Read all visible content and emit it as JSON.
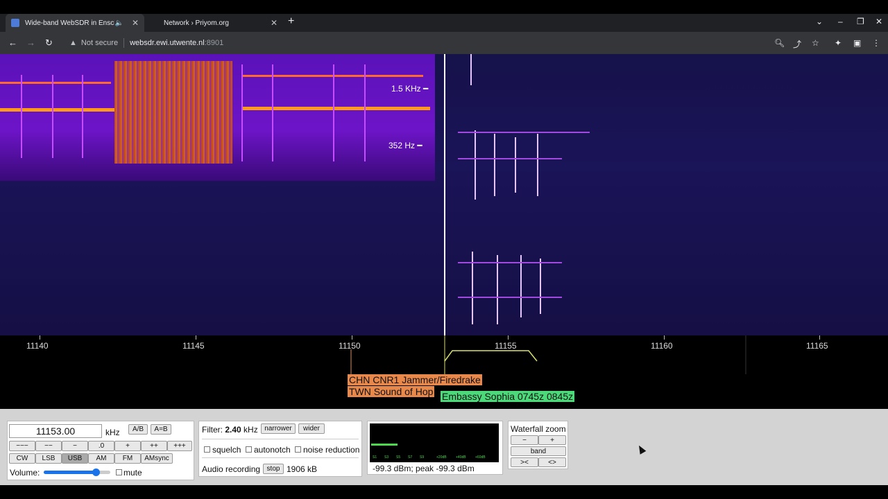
{
  "browser": {
    "tabs": [
      {
        "title": "Wide-band WebSDR in Ensch",
        "active": true
      },
      {
        "title": "Network › Priyom.org",
        "active": false
      }
    ],
    "security": "Not secure",
    "url_host": "websdr.ewi.utwente.nl",
    "url_port": ":8901"
  },
  "waterfall": {
    "marker_1": "1.5  KHz",
    "marker_2": "352  Hz"
  },
  "scale": {
    "ticks": [
      "11140",
      "11145",
      "11150",
      "11155",
      "11160",
      "11165"
    ]
  },
  "stations": {
    "s1": "CHN CNR1 Jammer/Firedrake",
    "s2": "TWN Sound of Hop",
    "s3": "Embassy Sophia 0745z 0845z"
  },
  "controls": {
    "frequency": "11153.00",
    "unit": "kHz",
    "ab": "A/B",
    "aeqb": "A=B",
    "steps": [
      "−−−",
      "−−",
      "−",
      ".0",
      "+",
      "++",
      "+++"
    ],
    "modes": [
      "CW",
      "LSB",
      "USB",
      "AM",
      "FM",
      "AMsync"
    ],
    "selected_mode": "USB",
    "volume_label": "Volume:",
    "volume_level": 0.78,
    "mute_label": "mute"
  },
  "filter": {
    "label": "Filter:",
    "value": "2.40",
    "unit": "kHz",
    "narrower": "narrower",
    "wider": "wider",
    "squelch": "squelch",
    "autonotch": "autonotch",
    "noise_reduction": "noise reduction",
    "audio_recording": "Audio recording",
    "stop": "stop",
    "size": "1906 kB"
  },
  "smeter": {
    "scale": [
      "S1",
      "S3",
      "S5",
      "S7",
      "S9",
      "+20dB",
      "+40dB",
      "+60dB"
    ],
    "reading": "-99.3 dBm; peak  -99.3 dBm"
  },
  "zoom": {
    "title": "Waterfall zoom",
    "minus": "−",
    "plus": "+",
    "band": "band",
    "narrow": "><",
    "wide": "<>"
  },
  "colors": {
    "station_orange": "#e8884a",
    "station_green": "#4cd97a",
    "passband": "#d8e070"
  }
}
